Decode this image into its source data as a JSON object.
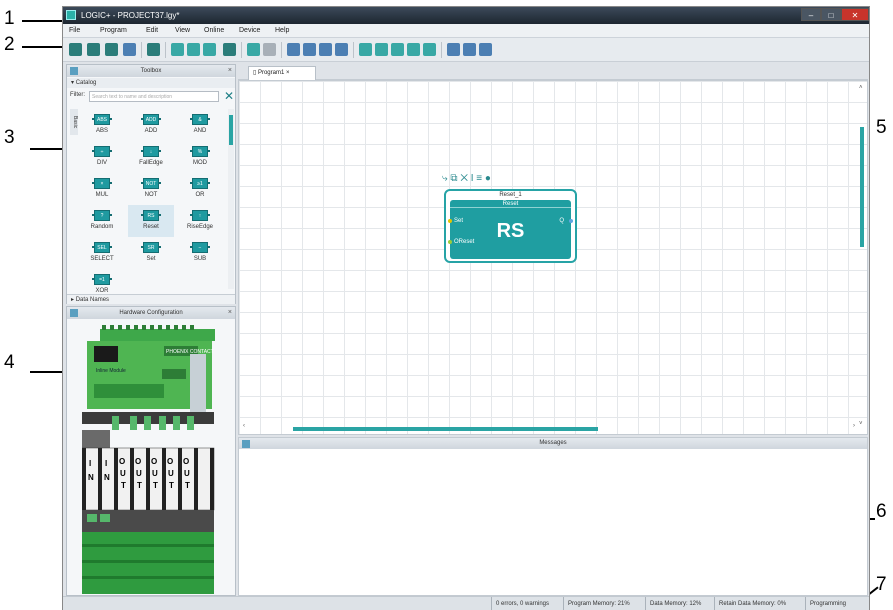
{
  "window": {
    "title": "LOGIC+ - PROJECT37.lgy*",
    "controls": [
      "–",
      "□",
      "✕"
    ]
  },
  "menu": [
    "File",
    "Program",
    "Edit",
    "View",
    "Online",
    "Device",
    "Help"
  ],
  "callouts": [
    "1",
    "2",
    "3",
    "4",
    "5",
    "6",
    "7"
  ],
  "toolbox": {
    "title": "Toolbox",
    "catalog_label": "Catalog",
    "filter_label": "Filter:",
    "filter_placeholder": "Search text to name and description",
    "tab_label": "Basic",
    "blocks": [
      {
        "label": "ABS",
        "icon": "ABS"
      },
      {
        "label": "ADD",
        "icon": "ADD"
      },
      {
        "label": "AND",
        "icon": "&"
      },
      {
        "label": "DIV",
        "icon": "÷"
      },
      {
        "label": "FallEdge",
        "icon": "↓"
      },
      {
        "label": "MOD",
        "icon": "%"
      },
      {
        "label": "MUL",
        "icon": "×"
      },
      {
        "label": "NOT",
        "icon": "NOT"
      },
      {
        "label": "OR",
        "icon": "≥1"
      },
      {
        "label": "Random",
        "icon": "?"
      },
      {
        "label": "Reset",
        "icon": "RS"
      },
      {
        "label": "RiseEdge",
        "icon": "↑"
      },
      {
        "label": "SELECT",
        "icon": "SEL"
      },
      {
        "label": "Set",
        "icon": "SR"
      },
      {
        "label": "SUB",
        "icon": "−"
      },
      {
        "label": "XOR",
        "icon": "=1"
      }
    ],
    "data_names": "Data Names"
  },
  "hardware": {
    "title": "Hardware Configuration",
    "io_labels": [
      "I N",
      "I N",
      "O U T",
      "O U T",
      "O U T",
      "O U T",
      "O U T"
    ],
    "module_brand": "PHOENIX CONTACT",
    "module_label": "Inline Module"
  },
  "editor": {
    "tab_label": "Program1",
    "block": {
      "instance_name": "Reset_1",
      "type_name": "Reset",
      "symbol": "RS",
      "input_set": "Set",
      "input_reset": "OReset",
      "output_q": "Q"
    }
  },
  "messages": {
    "title": "Messages"
  },
  "status": {
    "errors": "0 errors, 0 warnings",
    "program_memory": "Program Memory: 21%",
    "data_memory": "Data Memory: 12%",
    "retain_memory": "Retain Data Memory: 0%",
    "mode": "Programming"
  },
  "colors": {
    "accent": "#1f9ea1",
    "title_bar": "#1d2630",
    "hardware_green": "#3ea84a"
  }
}
